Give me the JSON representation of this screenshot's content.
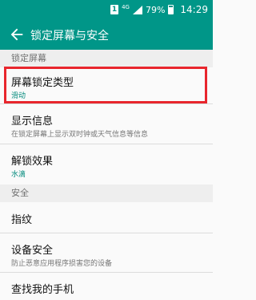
{
  "status_bar": {
    "sim_badge": "1",
    "network": "4G",
    "battery": "79%",
    "time": "14:29"
  },
  "action_bar": {
    "back_icon": "arrow-left-icon",
    "title": "锁定屏幕与安全"
  },
  "sections": [
    {
      "header": "锁定屏幕"
    },
    {
      "header": "安全"
    }
  ],
  "items": [
    {
      "title": "屏幕锁定类型",
      "subtitle": "滑动"
    },
    {
      "title": "显示信息",
      "subtitle": "在锁定屏幕上显示双时钟或天气信息等信息"
    },
    {
      "title": "解锁效果",
      "subtitle": "水滴"
    },
    {
      "title": "指纹",
      "subtitle": ""
    },
    {
      "title": "设备安全",
      "subtitle": "防止恶意应用程序损害您的设备"
    },
    {
      "title": "查找我的手机",
      "subtitle": ""
    }
  ],
  "colors": {
    "accent": "#009688",
    "highlight": "#e8262d"
  }
}
